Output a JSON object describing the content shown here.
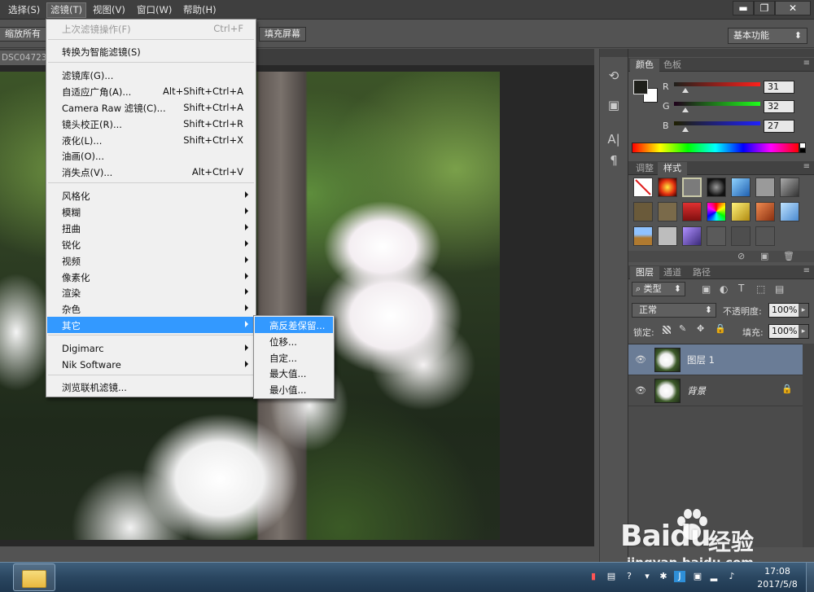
{
  "menubar": {
    "items": [
      "选择(S)",
      "滤镜(T)",
      "视图(V)",
      "窗口(W)",
      "帮助(H)"
    ],
    "active_index": 1
  },
  "window_controls": {
    "minimize": "▬",
    "restore": "❐",
    "close": "✕"
  },
  "options_bar": {
    "scroll_all": "缩放所有",
    "fill_screen": "填充屏幕",
    "workspace": "基本功能"
  },
  "document": {
    "tab_title": "DSC04723..."
  },
  "filter_menu": {
    "items": [
      {
        "label": "上次滤镜操作(F)",
        "shortcut": "Ctrl+F",
        "disabled": true
      },
      {
        "label": "转换为智能滤镜(S)",
        "shortcut": ""
      },
      {
        "label": "滤镜库(G)...",
        "shortcut": ""
      },
      {
        "label": "自适应广角(A)...",
        "shortcut": "Alt+Shift+Ctrl+A"
      },
      {
        "label": "Camera Raw 滤镜(C)...",
        "shortcut": "Shift+Ctrl+A"
      },
      {
        "label": "镜头校正(R)...",
        "shortcut": "Shift+Ctrl+R"
      },
      {
        "label": "液化(L)...",
        "shortcut": "Shift+Ctrl+X"
      },
      {
        "label": "油画(O)...",
        "shortcut": ""
      },
      {
        "label": "消失点(V)...",
        "shortcut": "Alt+Ctrl+V"
      },
      {
        "label": "风格化",
        "submenu": true
      },
      {
        "label": "模糊",
        "submenu": true
      },
      {
        "label": "扭曲",
        "submenu": true
      },
      {
        "label": "锐化",
        "submenu": true
      },
      {
        "label": "视频",
        "submenu": true
      },
      {
        "label": "像素化",
        "submenu": true
      },
      {
        "label": "渲染",
        "submenu": true
      },
      {
        "label": "杂色",
        "submenu": true
      },
      {
        "label": "其它",
        "submenu": true,
        "highlighted": true
      },
      {
        "label": "Digimarc",
        "submenu": true
      },
      {
        "label": "Nik Software",
        "submenu": true
      },
      {
        "label": "浏览联机滤镜..."
      }
    ]
  },
  "other_submenu": {
    "items": [
      {
        "label": "高反差保留...",
        "highlighted": true
      },
      {
        "label": "位移..."
      },
      {
        "label": "自定..."
      },
      {
        "label": "最大值..."
      },
      {
        "label": "最小值..."
      }
    ]
  },
  "color_panel": {
    "tabs": [
      "颜色",
      "色板"
    ],
    "active_tab": 0,
    "channels": [
      {
        "label": "R",
        "value": "31"
      },
      {
        "label": "G",
        "value": "32"
      },
      {
        "label": "B",
        "value": "27"
      }
    ],
    "foreground": "#1f201b",
    "background": "#ffffff"
  },
  "styles_panel": {
    "tabs": [
      "调整",
      "样式"
    ],
    "active_tab": 1
  },
  "layers_panel": {
    "tabs": [
      "图层",
      "通道",
      "路径"
    ],
    "active_tab": 0,
    "kind_filter": "类型",
    "blend_mode": "正常",
    "opacity_label": "不透明度:",
    "opacity_value": "100%",
    "lock_label": "锁定:",
    "fill_label": "填充:",
    "fill_value": "100%",
    "layers": [
      {
        "name": "图层 1",
        "selected": true,
        "locked": false
      },
      {
        "name": "背景",
        "selected": false,
        "locked": true
      }
    ]
  },
  "taskbar": {
    "time": "17:08",
    "date": "2017/5/8"
  },
  "watermark": {
    "brand": "Baidu",
    "product": "经验",
    "url": "jingyan.baidu.com"
  }
}
